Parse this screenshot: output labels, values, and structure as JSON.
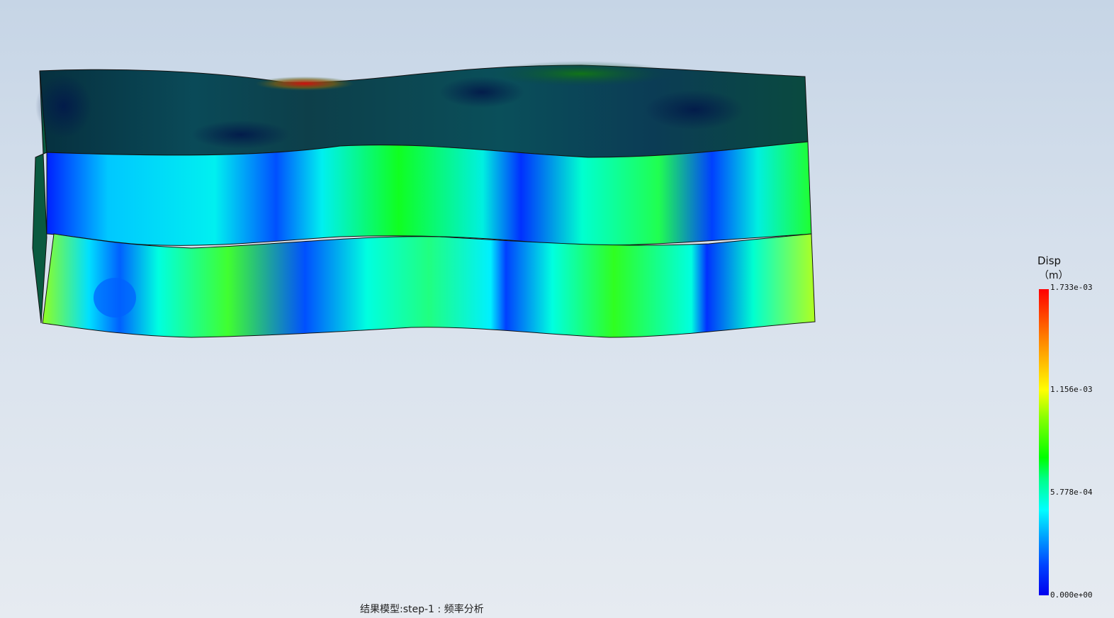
{
  "legend": {
    "title": "Disp",
    "unit": "（m）",
    "ticks": [
      "1.733e-03",
      "1.156e-03",
      "5.778e-04",
      "0.000e+00"
    ],
    "colors": [
      "#ff0000",
      "#ffff00",
      "#00ff00",
      "#00ffff",
      "#0000ee"
    ]
  },
  "caption": "结果模型:step-1 : 频率分析",
  "model": {
    "colors": {
      "top_face": "#0b4a5a",
      "middle_face": "#00f0f0",
      "bottom_face": "#28e04a",
      "node_blue": "#0030ff",
      "edge": "#111111"
    }
  }
}
